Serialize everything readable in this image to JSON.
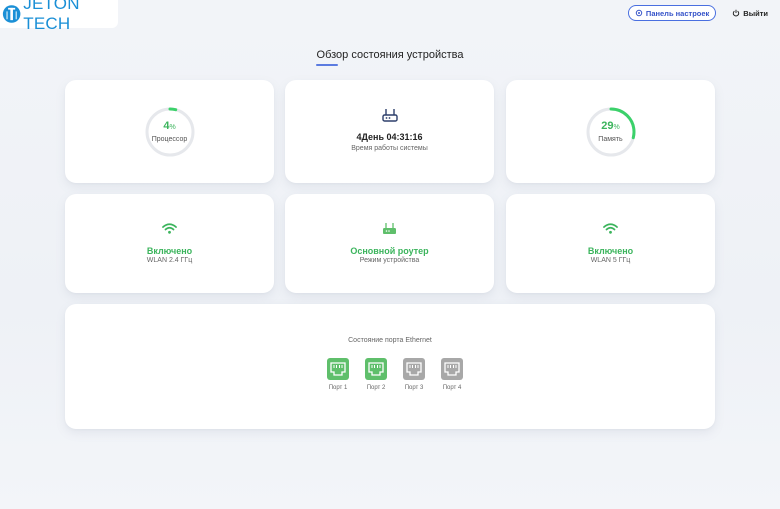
{
  "header": {
    "logo_text": "JETON TECH",
    "settings_label": "Панель настроек",
    "logout_label": "Выйти"
  },
  "page": {
    "title": "Обзор состояния устройства"
  },
  "cpu": {
    "value": "4",
    "unit": "%",
    "label": "Процессор",
    "percent": 4
  },
  "uptime": {
    "value": "4День 04:31:16",
    "label": "Время работы системы"
  },
  "memory": {
    "value": "29",
    "unit": "%",
    "label": "Память",
    "percent": 29
  },
  "wlan24": {
    "status": "Включено",
    "label": "WLAN 2.4 ГГц"
  },
  "mode": {
    "status": "Основной роутер",
    "label": "Режим устройства"
  },
  "wlan5": {
    "status": "Включено",
    "label": "WLAN 5 ГГц"
  },
  "ethernet": {
    "title": "Состояние порта Ethernet",
    "ports": [
      {
        "label": "Порт 1",
        "status": "up"
      },
      {
        "label": "Порт 2",
        "status": "up"
      },
      {
        "label": "Порт 3",
        "status": "down"
      },
      {
        "label": "Порт 4",
        "status": "down"
      }
    ]
  },
  "colors": {
    "accent_green": "#3bb45c",
    "brand_blue": "#1a8fd6",
    "port_up": "#5fbf6b",
    "port_down": "#a8a8a8"
  }
}
